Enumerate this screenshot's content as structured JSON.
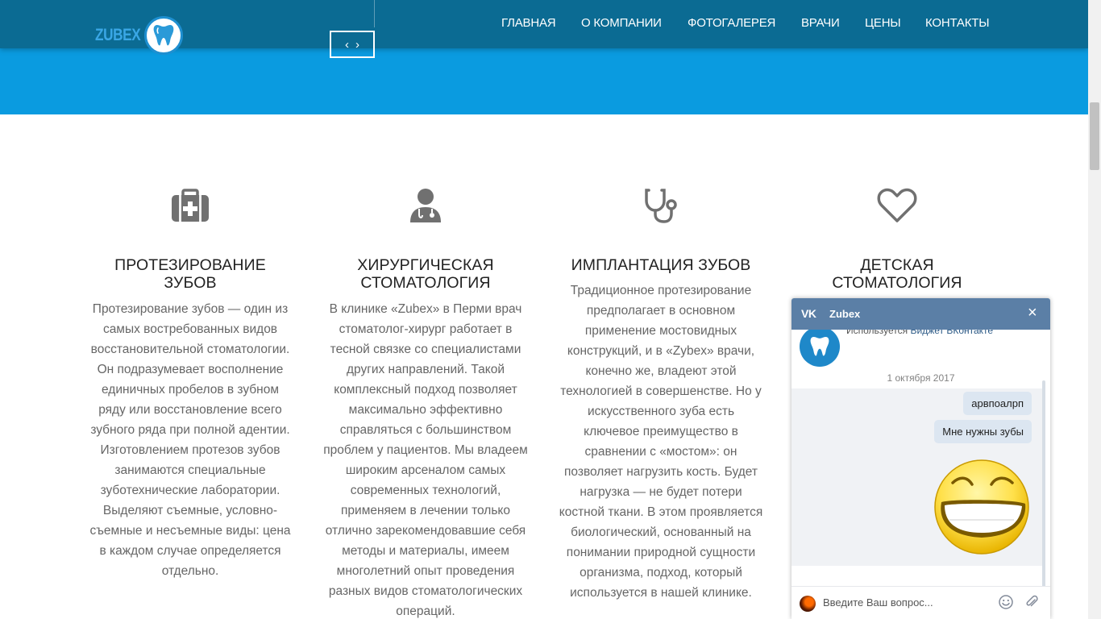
{
  "header": {
    "logo_text": "ZUBEX",
    "nav": [
      "ГЛАВНАЯ",
      "О КОМПАНИИ",
      "ФОТОГАЛЕРЕЯ",
      "ВРАЧИ",
      "ЦЕНЫ",
      "КОНТАКТЫ"
    ],
    "slider_prev": "‹",
    "slider_next": "›",
    "colors": {
      "topbar": "#0b6b93",
      "hero": "#0a9be0"
    }
  },
  "services": [
    {
      "icon": "medkit-icon",
      "title_line1": "ПРОТЕЗИРОВАНИЕ",
      "title_line2": "ЗУБОВ",
      "lines": [
        "Протезирование зубов — один из",
        "самых востребованных видов",
        "восстановительной стоматологии.",
        "Он подразумевает восполнение",
        "единичных пробелов в зубном",
        "ряду или восстановление всего",
        "зубного ряда при полной адентии.",
        "Изготовлением протезов зубов",
        "занимаются специальные",
        "зуботехнические лаборатории.",
        "Выделяют съемные, условно-",
        "съемные и несъемные виды: цена",
        "в каждом случае определяется",
        "отдельно."
      ]
    },
    {
      "icon": "doctor-icon",
      "title_line1": "ХИРУРГИЧЕСКАЯ",
      "title_line2": "СТОМАТОЛОГИЯ",
      "lines": [
        "В клинике «Zubex» в Перми врач",
        "стоматолог-хирург работает в",
        "тесной связке со специалистами",
        "других направлений. Такой",
        "комплексный подход позволяет",
        "максимально эффективно",
        "справляться с большинством",
        "проблем у пациентов. Мы владеем",
        "широким арсеналом самых",
        "современных технологий,",
        "применяем в лечении только",
        "отлично зарекомендовавшие себя",
        "методы и материалы, имеем",
        "многолетний опыт проведения",
        "разных видов стоматологических",
        "операций."
      ]
    },
    {
      "icon": "stethoscope-icon",
      "title_line1": "ИМПЛАНТАЦИЯ ЗУБОВ",
      "title_line2": "",
      "lines": [
        "Традиционное протезирование",
        "предполагает в основном",
        "применение мостовидных",
        "конструкций, и в «Zybex» врачи,",
        "конечно же, владеют этой",
        "технологией в совершенстве. Но у",
        "искусственного зуба есть",
        "ключевое преимущество в",
        "сравнении с «мостом»: он",
        "позволяет нагрузить кость. Будет",
        "нагрузка — не будет потери",
        "костной ткани. В этом проявляется",
        "биологический, основанный на",
        "понимании природной сущности",
        "организма, подход, который",
        "используется в нашей клинике."
      ]
    },
    {
      "icon": "heart-icon",
      "title_line1": "ДЕТСКАЯ",
      "title_line2": "СТОМАТОЛОГИЯ",
      "lines": []
    }
  ],
  "chat": {
    "network": "VK",
    "title": "Zubex",
    "close": "×",
    "uses_prefix": "Используется",
    "uses_link": "Виджет ВКонтакте",
    "date": "1 октября 2017",
    "messages": [
      "арвпоалрп",
      "Мне нужны зубы"
    ],
    "sticker": "laughing-smiley-sticker",
    "input_placeholder": "Введите Ваш вопрос...",
    "colors": {
      "header": "#5b7fa6",
      "bubble": "#dce6f1"
    }
  }
}
